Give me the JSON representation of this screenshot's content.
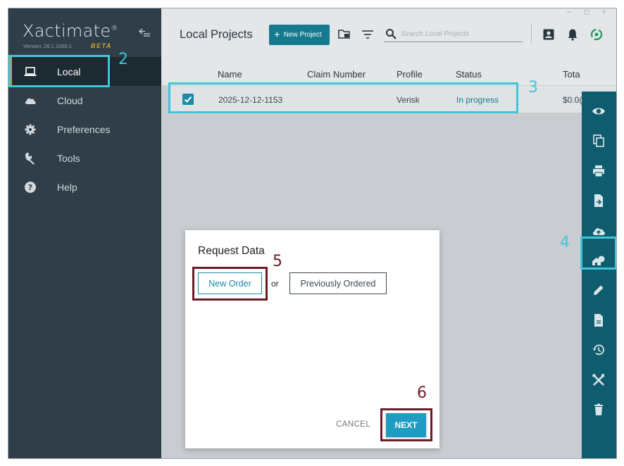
{
  "app": {
    "name": "Xactimate",
    "version": "Version: 28.1.1000.1",
    "beta": "BETA"
  },
  "window_controls": [
    "–",
    "◻",
    "×"
  ],
  "sidebar": {
    "items": [
      {
        "label": "Local",
        "icon": "laptop-icon",
        "active": true
      },
      {
        "label": "Cloud",
        "icon": "cloud-icon"
      },
      {
        "label": "Preferences",
        "icon": "gear-icon"
      },
      {
        "label": "Tools",
        "icon": "wrench-icon"
      },
      {
        "label": "Help",
        "icon": "help-icon"
      }
    ]
  },
  "header": {
    "title": "Local Projects",
    "new_project": "New Project",
    "search_placeholder": "Search Local Projects"
  },
  "table": {
    "columns": [
      "Name",
      "Claim Number",
      "Profile",
      "Status",
      "Tota"
    ],
    "rows": [
      {
        "name": "2025-12-12-1153",
        "claim_number": "",
        "profile": "Verisk",
        "status": "In progress",
        "total": "$0.0("
      }
    ]
  },
  "rail_icons": [
    "eye-icon",
    "copy-icon",
    "print-icon",
    "export-file-icon",
    "cloud-upload-icon",
    "request-data-icon",
    "edit-icon",
    "document-icon",
    "history-icon",
    "tools-icon",
    "trash-icon"
  ],
  "modal": {
    "title": "Request Data",
    "new_order": "New Order",
    "or": "or",
    "previously_ordered": "Previously Ordered",
    "cancel": "CANCEL",
    "next": "NEXT"
  },
  "annotations": {
    "n2": "2",
    "n3": "3",
    "n4": "4",
    "n5": "5",
    "n6": "6"
  },
  "colors": {
    "sidebar": "#2f3e48",
    "accent_teal": "#137a8f",
    "rail": "#0f5c6e",
    "active_marker": "#cf9a1f",
    "annotation_cyan": "#3fc6d9",
    "annotation_maroon": "#6f1a29",
    "next_button": "#1e9cc1"
  }
}
